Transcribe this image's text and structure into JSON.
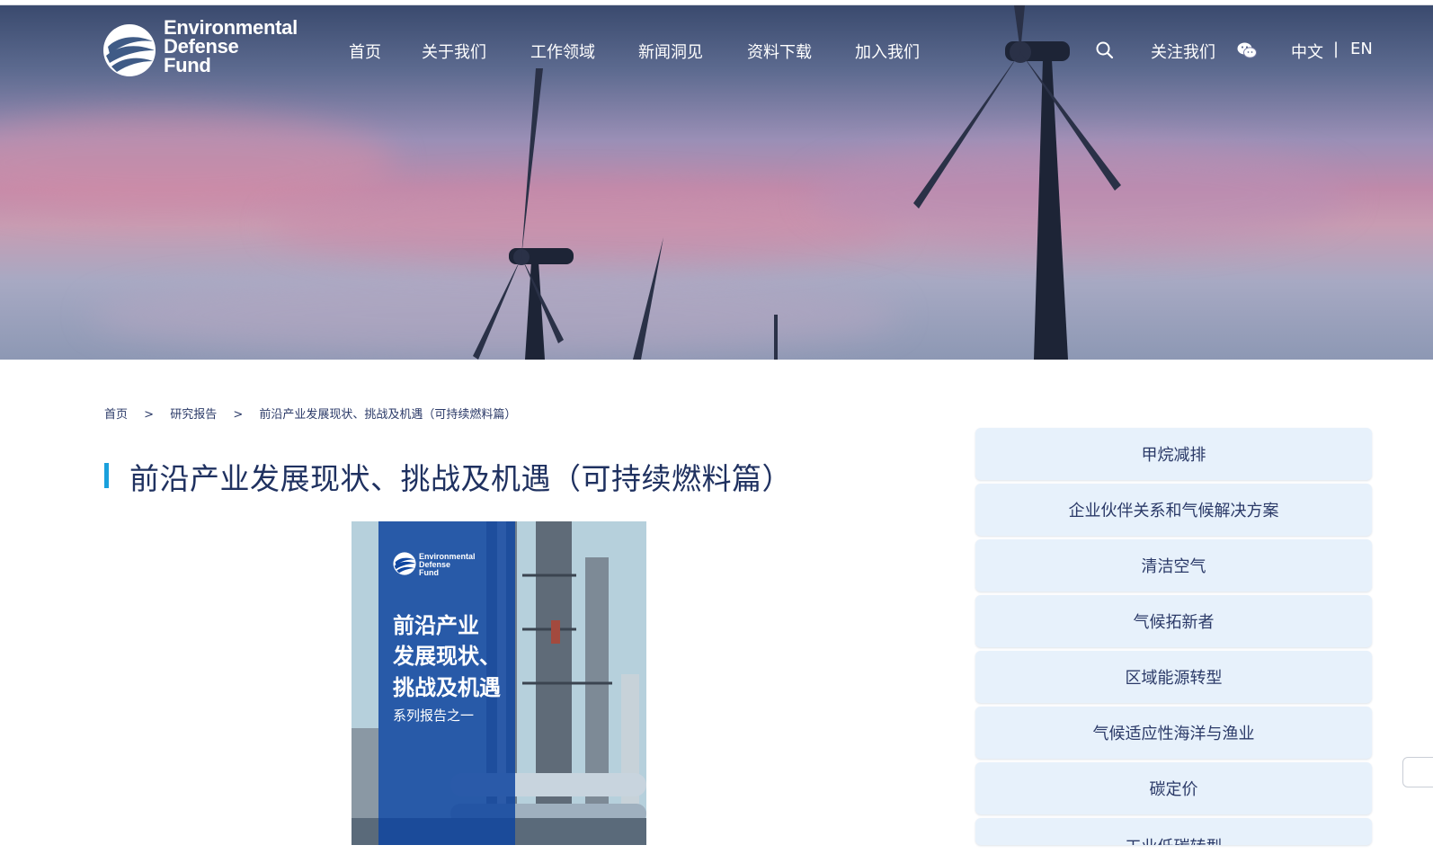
{
  "header": {
    "logo_lines": [
      "Environmental",
      "Defense",
      "Fund"
    ],
    "nav": [
      {
        "label": "首页"
      },
      {
        "label": "关于我们"
      },
      {
        "label": "工作领域"
      },
      {
        "label": "新闻洞见"
      },
      {
        "label": "资料下载"
      },
      {
        "label": "加入我们"
      }
    ],
    "follow_label": "关注我们",
    "lang_zh": "中文",
    "lang_sep": "|",
    "lang_en": "EN"
  },
  "breadcrumb": {
    "items": [
      "首页",
      "研究报告",
      "前沿产业发展现状、挑战及机遇（可持续燃料篇）"
    ],
    "separator": ">"
  },
  "page_title": "前沿产业发展现状、挑战及机遇（可持续燃料篇）",
  "cover": {
    "logo_lines": [
      "Environmental",
      "Defense",
      "Fund"
    ],
    "title_lines": [
      "前沿产业",
      "发展现状、",
      "挑战及机遇"
    ],
    "subtitle": "系列报告之一"
  },
  "sidebar": {
    "items": [
      {
        "label": "甲烷减排"
      },
      {
        "label": "企业伙伴关系和气候解决方案"
      },
      {
        "label": "清洁空气"
      },
      {
        "label": "气候拓新者"
      },
      {
        "label": "区域能源转型"
      },
      {
        "label": "气候适应性海洋与渔业"
      },
      {
        "label": "碳定价"
      },
      {
        "label": "工业低碳转型"
      }
    ]
  },
  "colors": {
    "title": "#1f3160",
    "accent_bar": "#1aa0dc",
    "sidebar_bg": "#e7f1fb",
    "cover_band": "#1046a0"
  }
}
